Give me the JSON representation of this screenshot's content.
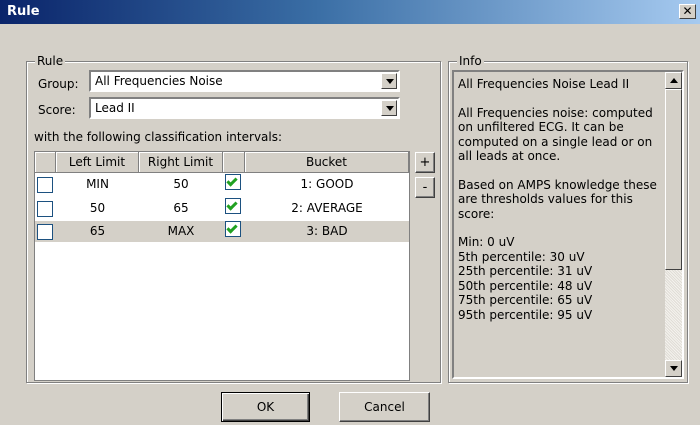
{
  "window": {
    "title": "Rule",
    "close_glyph": "✕"
  },
  "rule": {
    "legend": "Rule",
    "group_label": "Group:",
    "group_value": "All Frequencies Noise",
    "score_label": "Score:",
    "score_value": "Lead II",
    "intervals_caption": "with the following classification intervals:",
    "columns": [
      "",
      "Left Limit",
      "Right Limit",
      "",
      "Bucket"
    ],
    "rows": [
      {
        "checked": false,
        "left": "MIN",
        "right": "50",
        "enabled": true,
        "bucket": "1: GOOD",
        "selected": false
      },
      {
        "checked": false,
        "left": "50",
        "right": "65",
        "enabled": true,
        "bucket": "2: AVERAGE",
        "selected": false
      },
      {
        "checked": false,
        "left": "65",
        "right": "MAX",
        "enabled": true,
        "bucket": "3: BAD",
        "selected": true
      }
    ],
    "add_label": "+",
    "remove_label": "-"
  },
  "info": {
    "legend": "Info",
    "text": "All Frequencies Noise Lead II\n\nAll Frequencies noise: computed on unfiltered ECG. It can be computed on a single lead or on all leads at once.\n\nBased on AMPS knowledge these are thresholds values for this score:\n\nMin: 0 uV\n5th percentile: 30 uV\n25th percentile: 31 uV\n50th percentile: 48 uV\n75th percentile: 65 uV\n95th percentile: 95 uV"
  },
  "buttons": {
    "ok": "OK",
    "cancel": "Cancel"
  },
  "colors": {
    "title_start": "#0a246a",
    "title_end": "#a6caf0",
    "face": "#d4d0c8",
    "check": "#21a121",
    "checkbox_border": "#1c5180"
  },
  "icons": {
    "close": "close-icon",
    "dropdown": "chevron-down-icon",
    "check": "checkmark-icon",
    "scroll_up": "scroll-up-icon",
    "scroll_down": "scroll-down-icon"
  }
}
